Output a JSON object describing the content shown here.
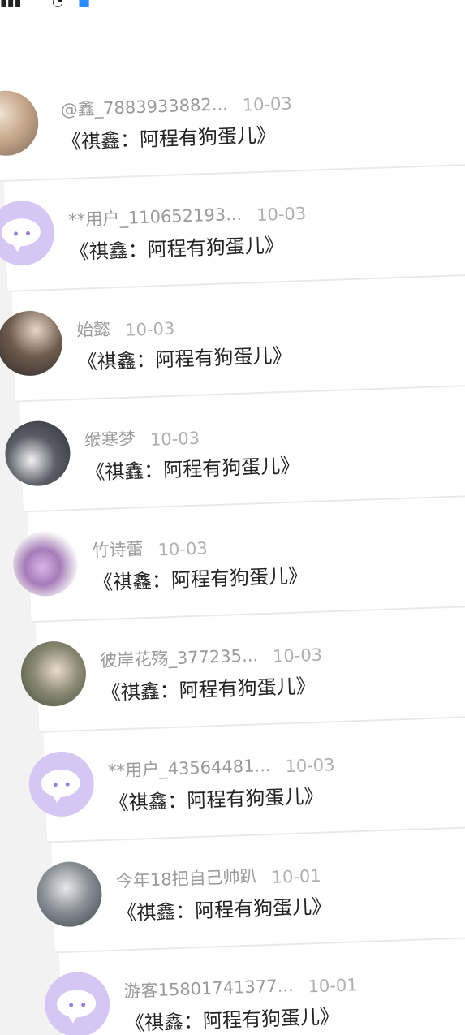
{
  "list": {
    "items": [
      {
        "username": "@鑫_7883933882...",
        "date": "10-03",
        "text": "《祺鑫：阿程有狗蛋儿》",
        "avatar": "photo-avatar"
      },
      {
        "username": "**用户_110652193...",
        "date": "10-03",
        "text": "《祺鑫：阿程有狗蛋儿》",
        "avatar": "default-chat-avatar"
      },
      {
        "username": "始懿",
        "date": "10-03",
        "text": "《祺鑫：阿程有狗蛋儿》",
        "avatar": "photo-avatar"
      },
      {
        "username": "缑寒梦",
        "date": "10-03",
        "text": "《祺鑫：阿程有狗蛋儿》",
        "avatar": "photo-avatar"
      },
      {
        "username": "竹诗蕾",
        "date": "10-03",
        "text": "《祺鑫：阿程有狗蛋儿》",
        "avatar": "photo-avatar"
      },
      {
        "username": "彼岸花殇_377235...",
        "date": "10-03",
        "text": "《祺鑫：阿程有狗蛋儿》",
        "avatar": "photo-avatar"
      },
      {
        "username": "**用户_43564481...",
        "date": "10-03",
        "text": "《祺鑫：阿程有狗蛋儿》",
        "avatar": "default-chat-avatar"
      },
      {
        "username": "今年18把自己帅趴",
        "date": "10-01",
        "text": "《祺鑫：阿程有狗蛋儿》",
        "avatar": "photo-avatar"
      },
      {
        "username": "游客15801741377...",
        "date": "10-01",
        "text": "《祺鑫：阿程有狗蛋儿》",
        "avatar": "default-chat-avatar"
      }
    ]
  },
  "icons": {
    "status": [
      "signal-icon",
      "wifi-icon",
      "notification-icon"
    ]
  }
}
